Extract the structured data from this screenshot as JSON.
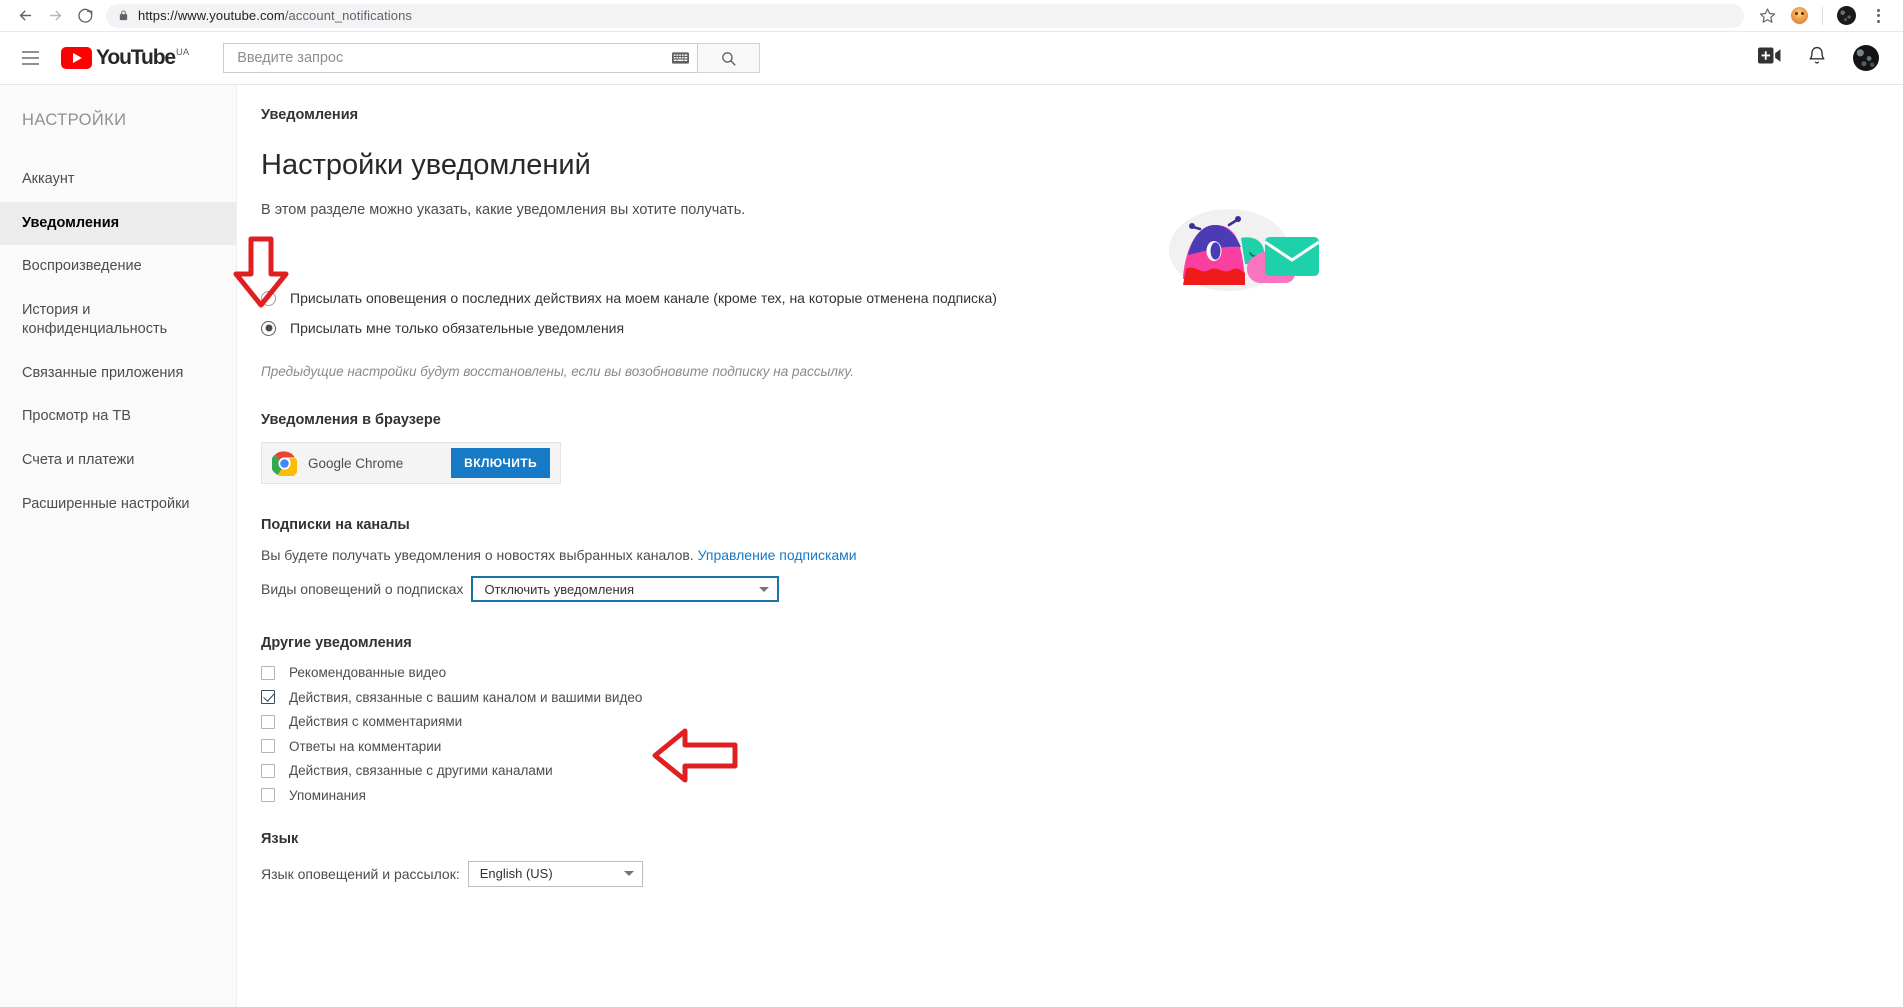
{
  "browser": {
    "url_scheme": "https://www.youtube.com",
    "url_path": "/account_notifications",
    "back_icon": "back-arrow-icon",
    "forward_icon": "forward-arrow-icon",
    "reload_icon": "reload-icon",
    "lock_icon": "lock-icon",
    "bookmark_icon": "star-icon",
    "extension_icon": "extension-icon",
    "profile_icon": "profile-avatar-icon",
    "menu_icon": "three-dot-menu-icon"
  },
  "masthead": {
    "menu_icon": "hamburger-menu-icon",
    "logo_text": "YouTube",
    "logo_country": "UA",
    "search_placeholder": "Введите запрос",
    "search_value": "",
    "keyboard_icon": "keyboard-icon",
    "search_icon": "search-icon",
    "create_icon": "video-camera-plus-icon",
    "notifications_icon": "bell-icon",
    "avatar_icon": "account-avatar"
  },
  "sidebar": {
    "title": "НАСТРОЙКИ",
    "items": [
      {
        "label": "Аккаунт",
        "active": false
      },
      {
        "label": "Уведомления",
        "active": true
      },
      {
        "label": "Воспроизведение",
        "active": false
      },
      {
        "label": "История и конфиденциальность",
        "active": false
      },
      {
        "label": "Связанные приложения",
        "active": false
      },
      {
        "label": "Просмотр на ТВ",
        "active": false
      },
      {
        "label": "Счета и платежи",
        "active": false
      },
      {
        "label": "Расширенные настройки",
        "active": false
      }
    ]
  },
  "main": {
    "breadcrumb": "Уведомления",
    "heading": "Настройки уведомлений",
    "subheading": "В этом разделе можно указать, какие уведомления вы хотите получать.",
    "hero_illustration": "bird-with-envelope-illustration",
    "radio_options": [
      {
        "label": "Присылать оповещения о последних действиях на моем канале (кроме тех, на которые отменена подписка)",
        "selected": false
      },
      {
        "label": "Присылать мне только обязательные уведомления",
        "selected": true
      }
    ],
    "restore_note": "Предыдущие настройки будут восстановлены, если вы возобновите подписку на рассылку.",
    "browser_section": {
      "title": "Уведомления в браузере",
      "browser_name": "Google Chrome",
      "browser_icon": "chrome-logo-icon",
      "enable_button": "ВКЛЮЧИТЬ",
      "enable_button_color": "#167ac6"
    },
    "subscriptions_section": {
      "title": "Подписки на каналы",
      "description": "Вы будете получать уведомления о новостях выбранных каналов.",
      "manage_link": "Управление подписками",
      "select_label": "Виды оповещений о подписках",
      "select_value": "Отключить уведомления",
      "select_focus_color": "#1a73a8"
    },
    "other_section": {
      "title": "Другие уведомления",
      "checkboxes": [
        {
          "label": "Рекомендованные видео",
          "checked": false
        },
        {
          "label": "Действия, связанные с вашим каналом и вашими видео",
          "checked": true
        },
        {
          "label": "Действия с комментариями",
          "checked": false
        },
        {
          "label": "Ответы на комментарии",
          "checked": false
        },
        {
          "label": "Действия, связанные с другими каналами",
          "checked": false
        },
        {
          "label": "Упоминания",
          "checked": false
        }
      ]
    },
    "language_section": {
      "title": "Язык",
      "select_label": "Язык оповещений и рассылок:",
      "select_value": "English (US)"
    }
  },
  "annotations": {
    "arrow_color": "#e02020",
    "arrow_down": "red-down-arrow-annotation",
    "arrow_left": "red-left-arrow-annotation"
  }
}
